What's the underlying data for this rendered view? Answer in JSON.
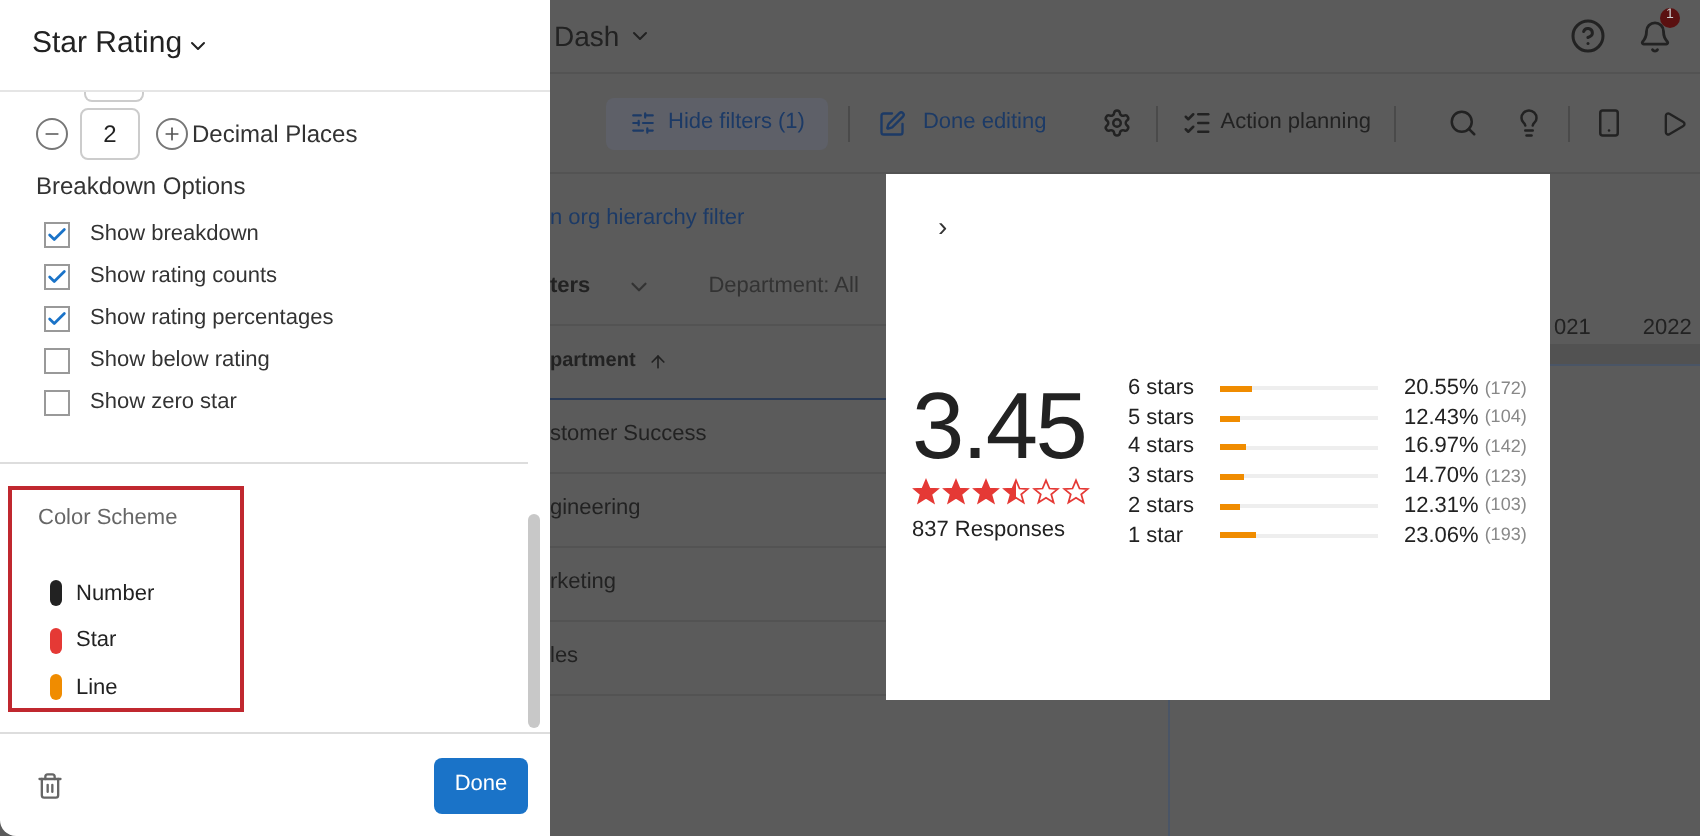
{
  "panel": {
    "title": "Star Rating",
    "decimal": {
      "value": "2",
      "label": "Decimal Places"
    },
    "breakdown_title": "Breakdown Options",
    "options": [
      {
        "label": "Show breakdown",
        "checked": true
      },
      {
        "label": "Show rating counts",
        "checked": true
      },
      {
        "label": "Show rating percentages",
        "checked": true
      },
      {
        "label": "Show below rating",
        "checked": false
      },
      {
        "label": "Show zero star",
        "checked": false
      }
    ],
    "color_scheme": {
      "title": "Color Scheme",
      "items": [
        {
          "label": "Number",
          "color": "#222222"
        },
        {
          "label": "Star",
          "color": "#e53935"
        },
        {
          "label": "Line",
          "color": "#f08c00"
        }
      ]
    },
    "done": "Done"
  },
  "header": {
    "title": "Dash",
    "badge": "1"
  },
  "toolbar": {
    "hide_filters": "Hide filters (1)",
    "done_editing": "Done editing",
    "action_planning": "Action planning"
  },
  "filter_link": "n org hierarchy filter",
  "filters": {
    "label": "ters",
    "department": "Department: All"
  },
  "table": {
    "column": "partment",
    "rows": [
      "stomer Success",
      "gineering",
      "rketing",
      "les"
    ]
  },
  "chart_years": [
    "021",
    "2022"
  ],
  "widget": {
    "chevron": "›",
    "score": "3.45",
    "stars": 3.5,
    "responses": "837 Responses",
    "rows": [
      {
        "label": "6 stars",
        "level": 0.2055,
        "percent": "20.55%",
        "count": "(172)"
      },
      {
        "label": "5 stars",
        "level": 0.1243,
        "percent": "12.43%",
        "count": "(104)"
      },
      {
        "label": "4 stars",
        "level": 0.1697,
        "percent": "16.97%",
        "count": "(142)"
      },
      {
        "label": "3 stars",
        "level": 0.147,
        "percent": "14.70%",
        "count": "(123)"
      },
      {
        "label": "2 stars",
        "level": 0.1231,
        "percent": "12.31%",
        "count": "(103)"
      },
      {
        "label": "1 star",
        "level": 0.2306,
        "percent": "23.06%",
        "count": "(193)"
      }
    ]
  }
}
